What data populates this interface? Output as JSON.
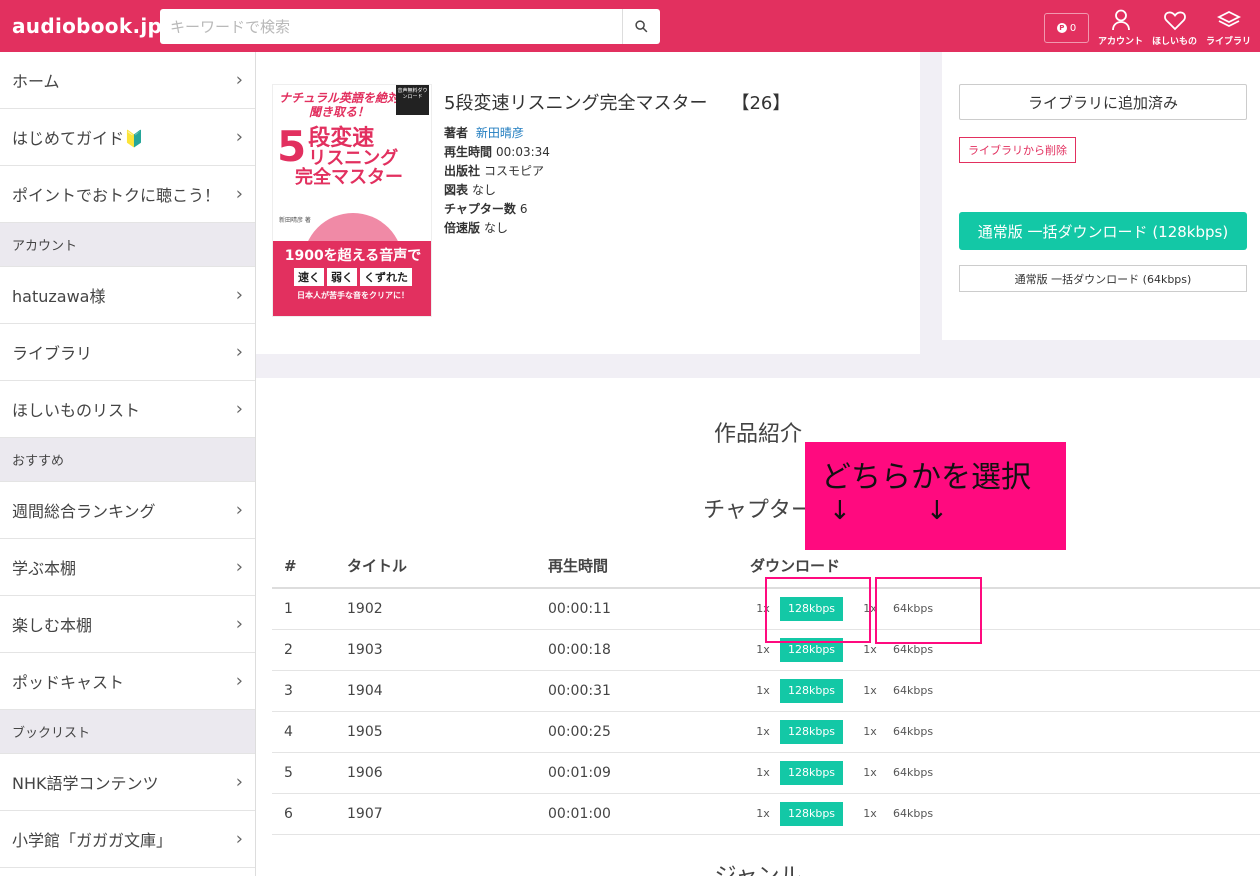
{
  "header": {
    "logo": "audiobook.jp",
    "search_placeholder": "キーワードで検索",
    "points": "0",
    "account_label": "アカウント",
    "wishlist_label": "ほしいもの",
    "library_label": "ライブラリ"
  },
  "sidebar": {
    "items": [
      {
        "label": "ホーム"
      },
      {
        "label": "はじめてガイド🔰"
      },
      {
        "label": "ポイントでおトクに聴こう！"
      }
    ],
    "account_section": "アカウント",
    "account_items": [
      {
        "label": "hatuzawa様"
      },
      {
        "label": "ライブラリ"
      },
      {
        "label": "ほしいものリスト"
      }
    ],
    "recommend_section": "おすすめ",
    "recommend_items": [
      {
        "label": "週間総合ランキング"
      },
      {
        "label": "学ぶ本棚"
      },
      {
        "label": "楽しむ本棚"
      },
      {
        "label": "ポッドキャスト"
      }
    ],
    "booklist_section": "ブックリスト",
    "booklist_items": [
      {
        "label": "NHK語学コンテンツ"
      },
      {
        "label": "小学館「ガガガ文庫」"
      }
    ]
  },
  "cover": {
    "top": "ナチュラル英語を絶対聞き取る！",
    "tag": "音声無料ダウンロード",
    "big": "5",
    "line1": "段変速",
    "line2": "リスニング",
    "line3": "完全マスター",
    "author": "新田晴彦 著",
    "pink1": "1900を超える音声で",
    "pink_words": [
      "速く",
      "弱く",
      "くずれた"
    ],
    "pink3": "日本人が苦手な音をクリアに！"
  },
  "book": {
    "title": "5段変速リスニング完全マスター",
    "count": "【26】",
    "author_key": "著者",
    "author": "新田晴彦",
    "duration_key": "再生時間",
    "duration": "00:03:34",
    "publisher_key": "出版社",
    "publisher": "コスモピア",
    "figures_key": "図表",
    "figures": "なし",
    "chapters_key": "チャプター数",
    "chapters": "6",
    "speed_key": "倍速版",
    "speed": "なし"
  },
  "actions": {
    "added": "ライブラリに追加済み",
    "remove": "ライブラリから削除",
    "download_128": "通常版 一括ダウンロード (128kbps)",
    "download_64": "通常版 一括ダウンロード (64kbps)"
  },
  "main": {
    "intro_title": "作品紹介",
    "chapter_title": "チャプター",
    "genre_title": "ジャンル",
    "table_headers": {
      "num": "#",
      "title": "タイトル",
      "time": "再生時間",
      "download": "ダウンロード"
    },
    "rows": [
      {
        "num": "1",
        "title": "1902",
        "time": "00:00:11",
        "x1": "1x",
        "hi": "128kbps",
        "x2": "1x",
        "lo": "64kbps"
      },
      {
        "num": "2",
        "title": "1903",
        "time": "00:00:18",
        "x1": "1x",
        "hi": "128kbps",
        "x2": "1x",
        "lo": "64kbps"
      },
      {
        "num": "3",
        "title": "1904",
        "time": "00:00:31",
        "x1": "1x",
        "hi": "128kbps",
        "x2": "1x",
        "lo": "64kbps"
      },
      {
        "num": "4",
        "title": "1905",
        "time": "00:00:25",
        "x1": "1x",
        "hi": "128kbps",
        "x2": "1x",
        "lo": "64kbps"
      },
      {
        "num": "5",
        "title": "1906",
        "time": "00:01:09",
        "x1": "1x",
        "hi": "128kbps",
        "x2": "1x",
        "lo": "64kbps"
      },
      {
        "num": "6",
        "title": "1907",
        "time": "00:01:00",
        "x1": "1x",
        "hi": "128kbps",
        "x2": "1x",
        "lo": "64kbps"
      }
    ]
  },
  "annotation": {
    "text": "どちらかを選択",
    "arrow": "↓"
  },
  "colors": {
    "brand": "#e2305f",
    "accent": "#13c8a6",
    "annotation": "#ff0a7f"
  }
}
